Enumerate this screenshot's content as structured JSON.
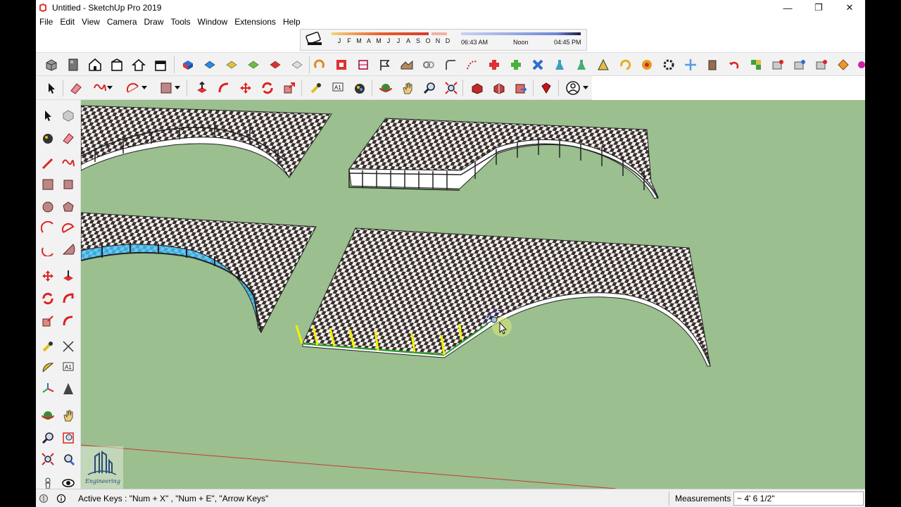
{
  "window": {
    "title": "Untitled - SketchUp Pro 2019"
  },
  "menu": [
    "File",
    "Edit",
    "View",
    "Camera",
    "Draw",
    "Tools",
    "Window",
    "Extensions",
    "Help"
  ],
  "shadow_settings": {
    "months": [
      "J",
      "F",
      "M",
      "A",
      "M",
      "J",
      "J",
      "A",
      "S",
      "O",
      "N",
      "D"
    ],
    "time_start": "06:43 AM",
    "time_mid": "Noon",
    "time_end": "04:45 PM"
  },
  "status": {
    "hint": "Active Keys : \"Num + X\" , \"Num + E\", \"Arrow Keys\"",
    "measurements_label": "Measurements",
    "measurements_value": "~ 4' 6 1/2\""
  },
  "logo": {
    "text": "Engineering"
  },
  "colors": {
    "viewport": "#9bbf8f",
    "accent_red": "#d62b2b",
    "accent_blue": "#1f6fd6"
  }
}
